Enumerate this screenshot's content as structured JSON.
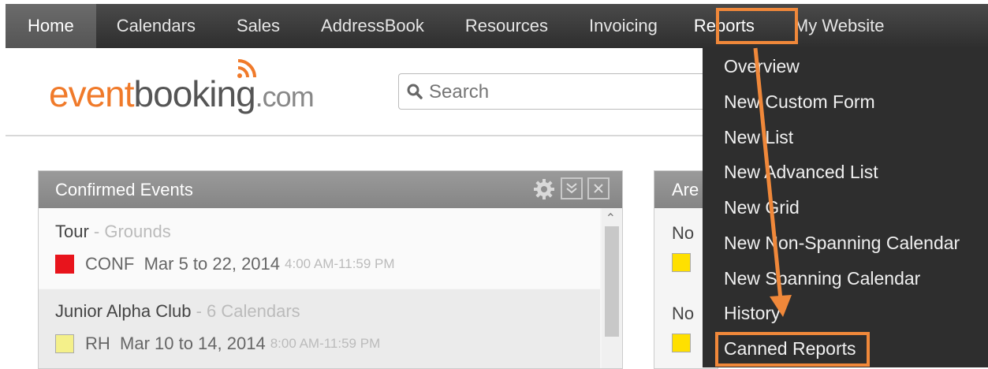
{
  "nav": {
    "items": [
      {
        "label": "Home"
      },
      {
        "label": "Calendars"
      },
      {
        "label": "Sales"
      },
      {
        "label": "AddressBook"
      },
      {
        "label": "Resources"
      },
      {
        "label": "Invoicing"
      },
      {
        "label": "Reports"
      },
      {
        "label": "My Website"
      }
    ],
    "active": "Home"
  },
  "logo": {
    "part1": "event",
    "part2": "booking",
    "part3": ".com"
  },
  "search": {
    "placeholder": "Search"
  },
  "panel_confirmed": {
    "title": "Confirmed Events",
    "events": [
      {
        "title": "Tour",
        "subtitle": "- Grounds",
        "code": "CONF",
        "dates": "Mar 5 to 22, 2014",
        "time": "4:00 AM-11:59 PM",
        "color": "#e8141c"
      },
      {
        "title": "Junior Alpha Club",
        "subtitle": "- 6 Calendars",
        "code": "RH",
        "dates": "Mar 10 to 14, 2014",
        "time": "8:00 AM-11:59 PM",
        "color": "#f4f08a"
      }
    ]
  },
  "panel_second": {
    "title": "Are",
    "rows": [
      {
        "text": "No",
        "color": "#ffe000"
      },
      {
        "text": "No",
        "color": "#ffe000"
      }
    ]
  },
  "reports_menu": {
    "items": [
      {
        "label": "Overview"
      },
      {
        "label": "New Custom Form"
      },
      {
        "label": "New List"
      },
      {
        "label": "New Advanced List"
      },
      {
        "label": "New Grid"
      },
      {
        "label": "New Non-Spanning Calendar"
      },
      {
        "label": "New Spanning Calendar"
      },
      {
        "label": "History"
      },
      {
        "label": "Canned Reports"
      }
    ]
  },
  "colors": {
    "accent": "#f07a2a",
    "highlight": "#f0883a",
    "nav_bg": "#3a3a3a",
    "menu_bg": "#2e2e2e"
  }
}
